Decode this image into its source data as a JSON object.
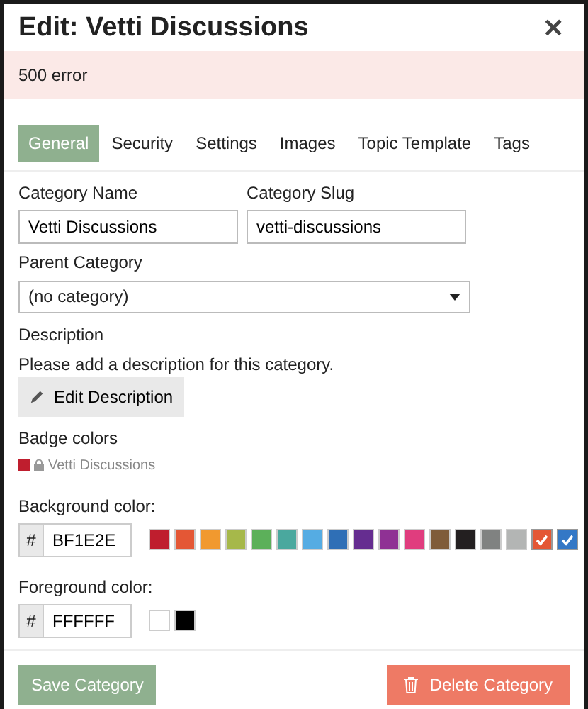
{
  "modal": {
    "title": "Edit: Vetti Discussions",
    "close": "✕"
  },
  "alert": "500 error",
  "tabs": [
    {
      "label": "General",
      "selected": true
    },
    {
      "label": "Security",
      "selected": false
    },
    {
      "label": "Settings",
      "selected": false
    },
    {
      "label": "Images",
      "selected": false
    },
    {
      "label": "Topic Template",
      "selected": false
    },
    {
      "label": "Tags",
      "selected": false
    }
  ],
  "fields": [
    {
      "label": "Category Name",
      "value": "Vetti Discussions"
    },
    {
      "label": "Category Slug",
      "value": "vetti-discussions"
    }
  ],
  "parent": {
    "label": "Parent Category",
    "value": "(no category)"
  },
  "description": {
    "label": "Description",
    "text": "Please add a description for this category.",
    "button": "Edit Description"
  },
  "badge": {
    "label": "Badge colors",
    "name": "Vetti Discussions",
    "color": "#bf1e2e"
  },
  "background": {
    "label": "Background color:",
    "prefix": "#",
    "value": "BF1E2E",
    "swatches": [
      {
        "color": "#bf1e2e",
        "selected": false
      },
      {
        "color": "#e45735",
        "selected": false
      },
      {
        "color": "#f1992f",
        "selected": false
      },
      {
        "color": "#a6b84a",
        "selected": false
      },
      {
        "color": "#5cb05a",
        "selected": false
      },
      {
        "color": "#4aa89e",
        "selected": false
      },
      {
        "color": "#55ace3",
        "selected": false
      },
      {
        "color": "#2f6fb6",
        "selected": false
      },
      {
        "color": "#652d90",
        "selected": false
      },
      {
        "color": "#8f3194",
        "selected": false
      },
      {
        "color": "#e03d7e",
        "selected": false
      },
      {
        "color": "#7f5c3a",
        "selected": false
      },
      {
        "color": "#231f20",
        "selected": false
      },
      {
        "color": "#808281",
        "selected": false
      },
      {
        "color": "#b3b5b4",
        "selected": false
      },
      {
        "color": "#e45735",
        "selected": true
      },
      {
        "color": "#3478c6",
        "selected": true
      }
    ]
  },
  "foreground": {
    "label": "Foreground color:",
    "prefix": "#",
    "value": "FFFFFF",
    "swatches": [
      {
        "color": "#ffffff",
        "selected": false
      },
      {
        "color": "#000000",
        "selected": false
      }
    ]
  },
  "footer": {
    "save": "Save Category",
    "delete": "Delete Category"
  }
}
